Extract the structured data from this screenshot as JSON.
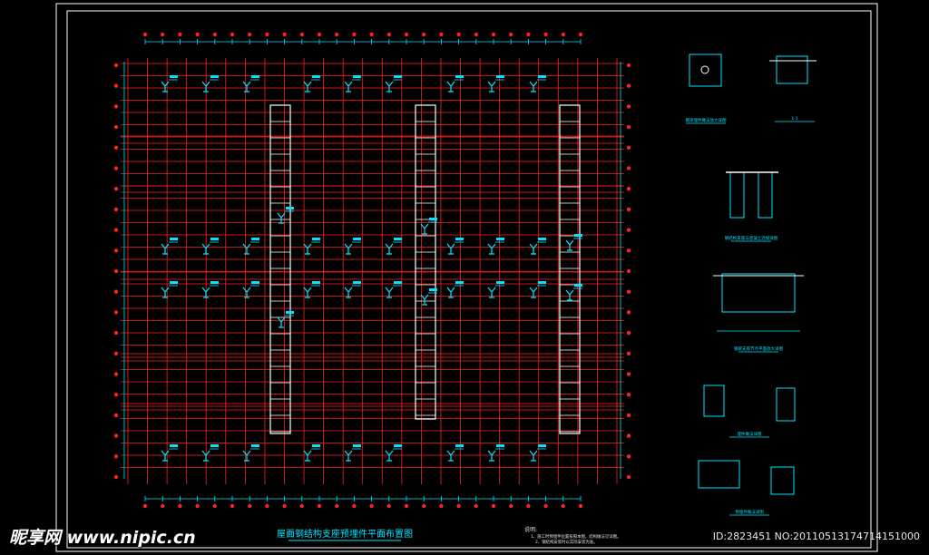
{
  "drawing": {
    "title": "屋面钢结构支座预埋件平面布置图",
    "notes_heading": "说明:",
    "notes": [
      "1、施工时预埋件位置按照本图，结构做法见详图。",
      "2、钢结构安装时以实际安装为准。"
    ],
    "detail_captions": [
      "钢梁埋件做法放大详图",
      "1-1",
      "钢结构支座与混凝土连接详图",
      "钢梁支座节点平面放大详图",
      "埋件做法详图",
      "预埋件做法详图"
    ],
    "colors": {
      "background": "#000000",
      "frame": "#ffffff",
      "grid": "#ff2020",
      "annotation": "#00e5ff"
    }
  },
  "watermark": {
    "site": "昵享网 www.nipic.cn",
    "id": "ID:2823451 NO:20110513174714151000"
  }
}
